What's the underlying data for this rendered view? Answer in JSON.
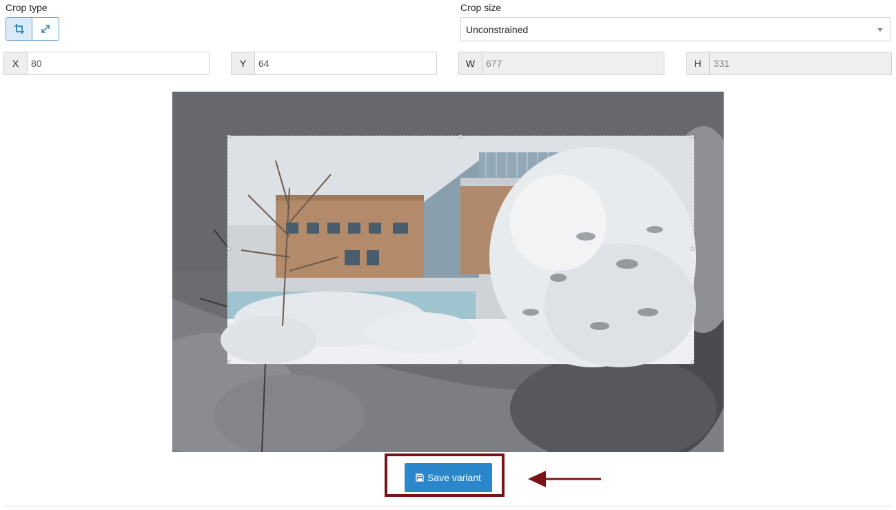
{
  "crop_type": {
    "label": "Crop type",
    "options": [
      {
        "name": "crop",
        "icon": "crop-icon",
        "active": true
      },
      {
        "name": "expand",
        "icon": "expand-icon",
        "active": false
      }
    ]
  },
  "crop_size": {
    "label": "Crop size",
    "selected": "Unconstrained"
  },
  "coords": {
    "x": {
      "label": "X",
      "value": "80"
    },
    "y": {
      "label": "Y",
      "value": "64"
    },
    "w": {
      "label": "W",
      "value": "677"
    },
    "h": {
      "label": "H",
      "value": "331"
    }
  },
  "save_button": {
    "label": "Save variant",
    "icon": "floppy-disk-icon"
  },
  "colors": {
    "accent": "#2a87cc",
    "highlight_outline": "#7a1414",
    "crop_overlay": "#5a5c60"
  }
}
